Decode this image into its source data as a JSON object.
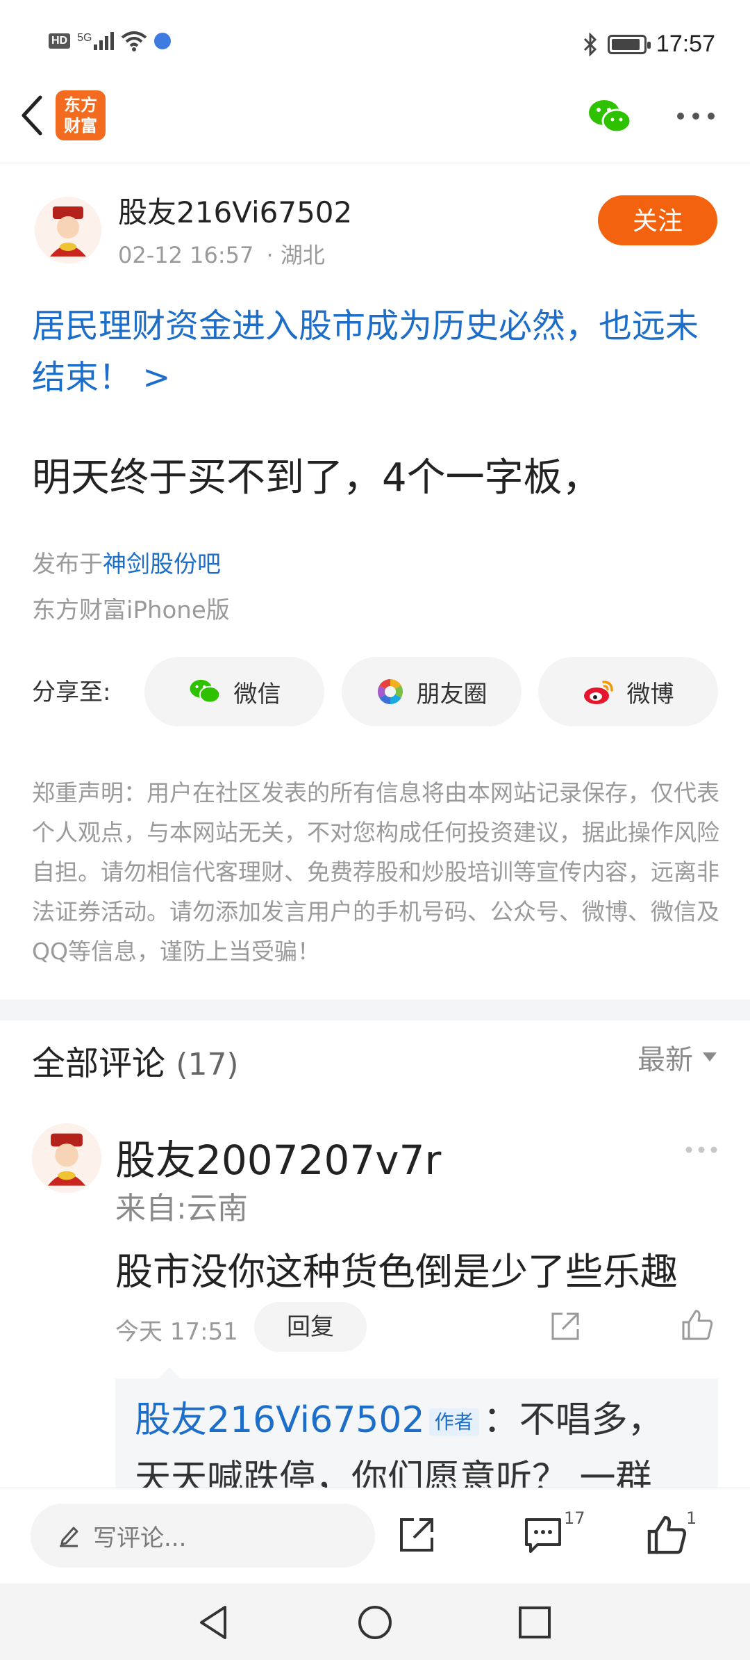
{
  "status_bar": {
    "left_icons": [
      "hd-icon",
      "5g-signal-icon",
      "wifi-icon",
      "vpn-icon"
    ],
    "hd_label": "HD",
    "net_label": "5G",
    "right_icons": [
      "bluetooth-icon",
      "battery-icon"
    ],
    "time": "17:57"
  },
  "nav": {
    "logo_text_line1": "东方",
    "logo_text_line2": "财富"
  },
  "post": {
    "author_name": "股友216Vi67502",
    "date": "02-12 16:57",
    "location": "· 湖北",
    "follow_label": "关注",
    "topic": "居民理财资金进入股市成为历史必然，也远未结束！ >",
    "body": "明天终于买不到了，4个一字板，",
    "published_prefix": "发布于",
    "published_bar": "神剑股份吧",
    "client": "东方财富iPhone版"
  },
  "share": {
    "label": "分享至:",
    "buttons": [
      {
        "label": "微信",
        "icon": "wechat-icon"
      },
      {
        "label": "朋友圈",
        "icon": "moments-icon"
      },
      {
        "label": "微博",
        "icon": "weibo-icon"
      }
    ]
  },
  "disclaimer": "郑重声明：用户在社区发表的所有信息将由本网站记录保存，仅代表个人观点，与本网站无关，不对您构成任何投资建议，据此操作风险自担。请勿相信代客理财、免费荐股和炒股培训等宣传内容，远离非法证券活动。请勿添加发言用户的手机号码、公众号、微博、微信及QQ等信息，谨防上当受骗！",
  "comments": {
    "title": "全部评论",
    "count": "(17)",
    "sort_label": "最新",
    "items": [
      {
        "name": "股友2007207v7r",
        "from": "来自:云南",
        "text": "股市没你这种货色倒是少了些乐趣",
        "time": "今天 17:51",
        "reply_label": "回复",
        "sub_reply": {
          "user": "股友216Vi67502",
          "badge": "作者",
          "text": "：不唱多，天天喊跌停，你们愿意听？ 一群"
        }
      }
    ]
  },
  "bottom_bar": {
    "placeholder": "写评论...",
    "comment_count": "17",
    "like_count": "1"
  },
  "colors": {
    "accent_orange": "#f3620e",
    "link_blue": "#1d6ec8"
  }
}
